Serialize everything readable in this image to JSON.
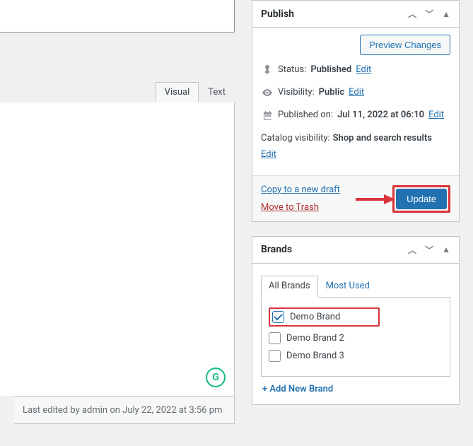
{
  "editor": {
    "tabs": {
      "visual": "Visual",
      "text": "Text"
    },
    "last_edited": "Last edited by admin on July 22, 2022 at 3:56 pm",
    "grammarly": "G"
  },
  "publish": {
    "title": "Publish",
    "preview": "Preview Changes",
    "status_label": "Status:",
    "status_value": "Published",
    "visibility_label": "Visibility:",
    "visibility_value": "Public",
    "publishedon_label": "Published on:",
    "publishedon_value": "Jul 11, 2022 at 06:10",
    "catalog_label": "Catalog visibility:",
    "catalog_value": "Shop and search results",
    "edit": "Edit",
    "copy": "Copy to a new draft",
    "trash": "Move to Trash",
    "update": "Update"
  },
  "brands": {
    "title": "Brands",
    "tabs": {
      "all": "All Brands",
      "most": "Most Used"
    },
    "items": [
      {
        "label": "Demo Brand",
        "checked": true,
        "highlight": true
      },
      {
        "label": "Demo Brand 2",
        "checked": false,
        "highlight": false
      },
      {
        "label": "Demo Brand 3",
        "checked": false,
        "highlight": false
      }
    ],
    "add_new": "+ Add New Brand"
  }
}
